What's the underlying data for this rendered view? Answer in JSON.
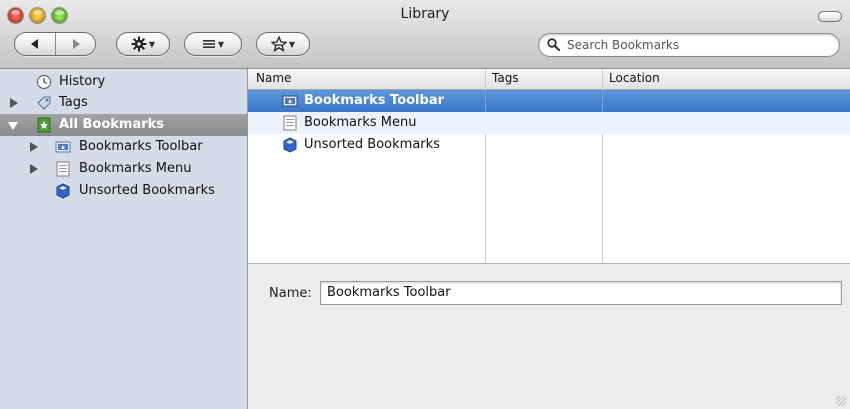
{
  "window": {
    "title": "Library"
  },
  "toolbar": {
    "back_icon": "back-arrow-icon",
    "forward_icon": "forward-arrow-icon",
    "organize_icon": "gear-icon",
    "views_icon": "list-icon",
    "import_icon": "star-icon"
  },
  "search": {
    "placeholder": "Search Bookmarks",
    "value": ""
  },
  "sidebar": {
    "items": [
      {
        "label": "History",
        "icon": "clock-icon"
      },
      {
        "label": "Tags",
        "icon": "tag-icon"
      },
      {
        "label": "All Bookmarks",
        "icon": "bookmarks-icon"
      },
      {
        "label": "Bookmarks Toolbar",
        "icon": "toolbar-folder-icon"
      },
      {
        "label": "Bookmarks Menu",
        "icon": "menu-folder-icon"
      },
      {
        "label": "Unsorted Bookmarks",
        "icon": "unsorted-icon"
      }
    ]
  },
  "table": {
    "columns": [
      "Name",
      "Tags",
      "Location"
    ],
    "rows": [
      {
        "name": "Bookmarks Toolbar",
        "tags": "",
        "location": ""
      },
      {
        "name": "Bookmarks Menu",
        "tags": "",
        "location": ""
      },
      {
        "name": "Unsorted Bookmarks",
        "tags": "",
        "location": ""
      }
    ]
  },
  "details": {
    "name_label": "Name:",
    "name_value": "Bookmarks Toolbar"
  },
  "colors": {
    "selection": "#3a76c9",
    "sidebar_bg": "#d4dce8",
    "sidebar_selected": "#8b8b8b",
    "alt_row": "#edf3fe"
  }
}
